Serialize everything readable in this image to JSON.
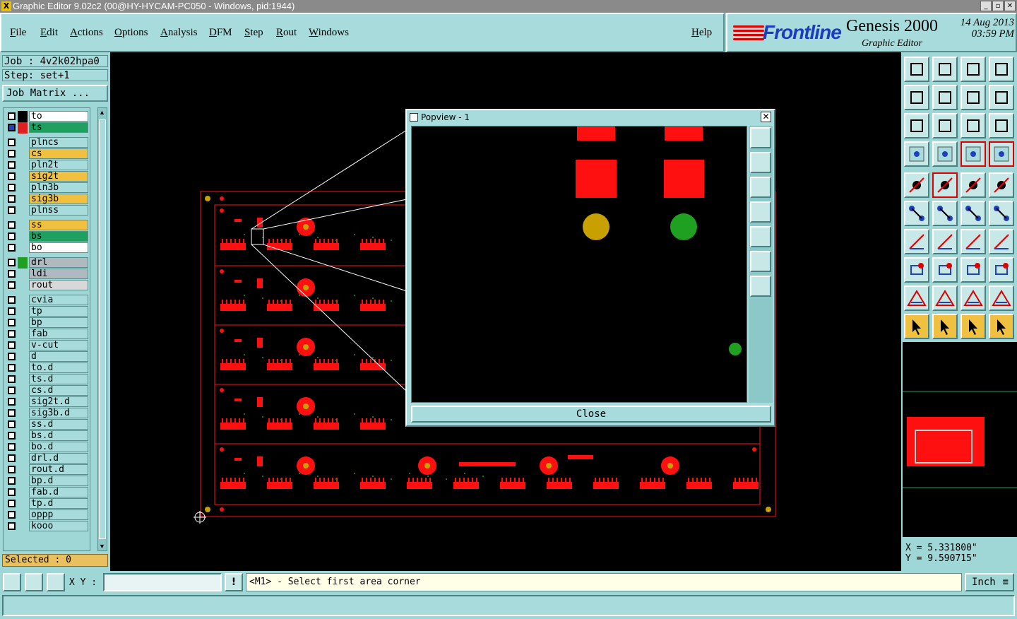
{
  "window": {
    "title": "Graphic Editor 9.02c2 (00@HY-HYCAM-PC050 - Windows, pid:1944)",
    "app_icon": "x-icon"
  },
  "menu": [
    "File",
    "Edit",
    "Actions",
    "Options",
    "Analysis",
    "DFM",
    "Step",
    "Rout",
    "Windows"
  ],
  "help_label": "Help",
  "brand": {
    "logo": "Frontline",
    "product": "Genesis 2000",
    "subtitle": "Graphic Editor",
    "date": "14 Aug 2013",
    "time": "03:59 PM"
  },
  "job": {
    "label": "Job : 4v2k02hpa0",
    "step": "Step: set+1",
    "matrix_button": "Job Matrix ..."
  },
  "layers": [
    {
      "name": "to",
      "color": "#ffffff",
      "swatch": "#000000"
    },
    {
      "name": "ts",
      "color": "#20a060",
      "swatch": "#e02020",
      "active": true
    },
    {
      "name": "plncs",
      "color": "#a8dcdc"
    },
    {
      "name": "cs",
      "color": "#f0c040"
    },
    {
      "name": "pln2t",
      "color": "#a8dcdc"
    },
    {
      "name": "sig2t",
      "color": "#f0c040"
    },
    {
      "name": "pln3b",
      "color": "#a8dcdc"
    },
    {
      "name": "sig3b",
      "color": "#f0c040"
    },
    {
      "name": "plnss",
      "color": "#a8dcdc"
    },
    {
      "name": "ss",
      "color": "#f0c040"
    },
    {
      "name": "bs",
      "color": "#20a060"
    },
    {
      "name": "bo",
      "color": "#ffffff"
    },
    {
      "name": "drl",
      "color": "#b0b8c0",
      "swatch": "#20a020"
    },
    {
      "name": "ldi",
      "color": "#b0b8c0"
    },
    {
      "name": "rout",
      "color": "#d8d8d8"
    },
    {
      "name": "cvia",
      "color": "#a8dcdc"
    },
    {
      "name": "tp",
      "color": "#a8dcdc"
    },
    {
      "name": "bp",
      "color": "#a8dcdc"
    },
    {
      "name": "fab",
      "color": "#a8dcdc"
    },
    {
      "name": "v-cut",
      "color": "#a8dcdc"
    },
    {
      "name": "d",
      "color": "#a8dcdc"
    },
    {
      "name": "to.d",
      "color": "#a8dcdc"
    },
    {
      "name": "ts.d",
      "color": "#a8dcdc"
    },
    {
      "name": "cs.d",
      "color": "#a8dcdc"
    },
    {
      "name": "sig2t.d",
      "color": "#a8dcdc"
    },
    {
      "name": "sig3b.d",
      "color": "#a8dcdc"
    },
    {
      "name": "ss.d",
      "color": "#a8dcdc"
    },
    {
      "name": "bs.d",
      "color": "#a8dcdc"
    },
    {
      "name": "bo.d",
      "color": "#a8dcdc"
    },
    {
      "name": "drl.d",
      "color": "#a8dcdc"
    },
    {
      "name": "rout.d",
      "color": "#a8dcdc"
    },
    {
      "name": "bp.d",
      "color": "#a8dcdc"
    },
    {
      "name": "fab.d",
      "color": "#a8dcdc"
    },
    {
      "name": "tp.d",
      "color": "#a8dcdc"
    },
    {
      "name": "oppp",
      "color": "#a8dcdc"
    },
    {
      "name": "kooo",
      "color": "#a8dcdc"
    }
  ],
  "selected": "Selected : 0",
  "popview": {
    "title": "Popview - 1",
    "close_label": "Close",
    "close_icon": "x-icon"
  },
  "coords": {
    "x": "X = 5.331800\"",
    "y": "Y = 9.590715\""
  },
  "bottom": {
    "xy_label": "X Y :",
    "xy_value": "",
    "prompt": "<M1> - Select first area corner",
    "unit": "Inch"
  },
  "toolbar_icons": [
    "zoom-home-icon",
    "zoom-in-icon",
    "home-icon",
    "split-view-icon",
    "pan-left-icon",
    "pan-right-icon",
    "fit-icon",
    "snap-icon",
    "zoom-fit-icon",
    "zoom-center-icon",
    "ratio-icon",
    "help-icon",
    "measure-settings-icon",
    "grid-icon",
    "layer-compare-icon",
    "layer-compare2-icon",
    "select-point-icon",
    "line-draw-icon",
    "ruler-icon",
    "circle-icon",
    "nodes-icon",
    "cross-icon",
    "arc-snap-icon",
    "arc-snap2-icon",
    "angle-icon",
    "line-icon",
    "rotate-icon",
    "mirror-icon",
    "pad-icon",
    "minus-icon",
    "dimension-icon",
    "shapes-icon",
    "triangle-icon",
    "triangle2-icon",
    "triangle3-icon",
    "triangle4-icon",
    "pointer-icon",
    "pointer-select-icon",
    "pointer-area-icon",
    "route-icon"
  ],
  "colors": {
    "accent": "#9fd6d6",
    "pcb_red": "#ff1010",
    "pad_yellow": "#c8a000",
    "pad_green": "#20a020"
  }
}
